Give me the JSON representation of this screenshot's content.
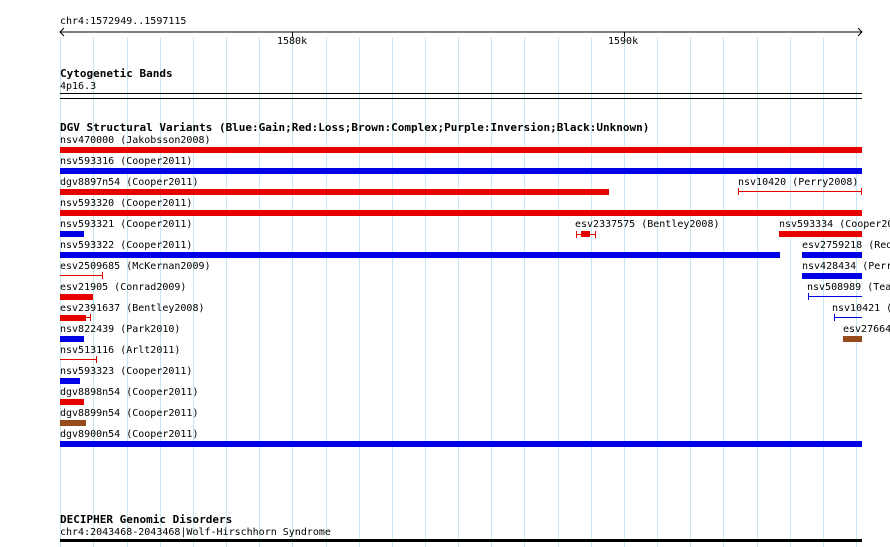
{
  "ruler": {
    "location": "chr4:1572949..1597115",
    "tick_1580": "1580k",
    "tick_1590": "1590k"
  },
  "cytoband": {
    "title": "Cytogenetic Bands",
    "band": "4p16.3"
  },
  "dgv": {
    "title": "DGV Structural Variants (Blue:Gain;Red:Loss;Brown:Complex;Purple:Inversion;Black:Unknown)",
    "colors": {
      "gain": "#0000e6",
      "loss": "#e60000",
      "complex": "#964b1e"
    },
    "rows": [
      {
        "id": "r1",
        "label": "nsv470000 (Jakobsson2008)",
        "type": "loss"
      },
      {
        "id": "r2",
        "label": "nsv593316 (Cooper2011)",
        "type": "gain"
      },
      {
        "id": "r3",
        "label": "dgv8897n54 (Cooper2011)",
        "type": "loss"
      },
      {
        "id": "r3b",
        "label": "nsv10420 (Perry2008)",
        "type": "loss"
      },
      {
        "id": "r4",
        "label": "nsv593320 (Cooper2011)",
        "type": "loss"
      },
      {
        "id": "r5",
        "label": "nsv593321 (Cooper2011)",
        "type": "gain"
      },
      {
        "id": "r5b",
        "label": "esv2337575 (Bentley2008)",
        "type": "loss"
      },
      {
        "id": "r5c",
        "label": "nsv593334 (Cooper20",
        "type": "loss"
      },
      {
        "id": "r6",
        "label": "nsv593322 (Cooper2011)",
        "type": "gain"
      },
      {
        "id": "r6b",
        "label": "esv2759218 (Red",
        "type": "gain"
      },
      {
        "id": "r7",
        "label": "esv2509685 (McKernan2009)",
        "type": "loss"
      },
      {
        "id": "r7b",
        "label": "nsv428434 (Perr",
        "type": "gain"
      },
      {
        "id": "r8",
        "label": "esv21905 (Conrad2009)",
        "type": "loss"
      },
      {
        "id": "r8b",
        "label": "nsv508989 (Tea",
        "type": "gain"
      },
      {
        "id": "r9",
        "label": "esv2391637 (Bentley2008)",
        "type": "loss"
      },
      {
        "id": "r9b",
        "label": "nsv10421 (",
        "type": "gain"
      },
      {
        "id": "r10",
        "label": "nsv822439 (Park2010)",
        "type": "gain"
      },
      {
        "id": "r10b",
        "label": "esv27664",
        "type": "complex"
      },
      {
        "id": "r11",
        "label": "nsv513116 (Arlt2011)",
        "type": "loss"
      },
      {
        "id": "r12",
        "label": "nsv593323 (Cooper2011)",
        "type": "gain"
      },
      {
        "id": "r13",
        "label": "dgv8898n54 (Cooper2011)",
        "type": "loss"
      },
      {
        "id": "r14",
        "label": "dgv8899n54 (Cooper2011)",
        "type": "complex"
      },
      {
        "id": "r15",
        "label": "dgv8900n54 (Cooper2011)",
        "type": "gain"
      }
    ]
  },
  "decipher": {
    "title": "DECIPHER Genomic Disorders",
    "item": "chr4:2043468-2043468|Wolf-Hirschhorn Syndrome"
  }
}
